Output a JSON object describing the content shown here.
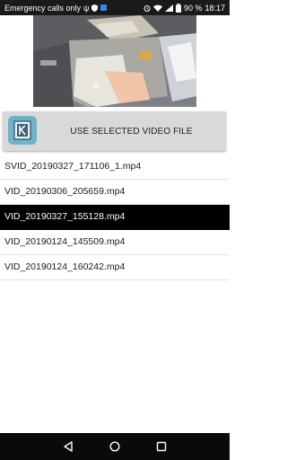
{
  "status_bar": {
    "carrier_text": "Emergency calls only",
    "battery_percent": "90 %",
    "time": "18:17",
    "icons": [
      "usb-icon",
      "shield-icon",
      "tile-icon",
      "alarm-icon",
      "wifi-icon",
      "signal-icon",
      "battery-icon"
    ]
  },
  "action_button": {
    "label": "USE SELECTED VIDEO FILE",
    "logo_icon": "app-logo-icon"
  },
  "file_list": {
    "items": [
      {
        "name": "SVID_20190327_171106_1.mp4",
        "selected": false
      },
      {
        "name": "VID_20190306_205659.mp4",
        "selected": false
      },
      {
        "name": "VID_20190327_155128.mp4",
        "selected": true
      },
      {
        "name": "VID_20190124_145509.mp4",
        "selected": false
      },
      {
        "name": "VID_20190124_160242.mp4",
        "selected": false
      }
    ]
  },
  "nav_bar": {
    "icons": [
      "back-icon",
      "home-icon",
      "recents-icon"
    ]
  },
  "colors": {
    "status_bar_bg": "#1a1a1a",
    "button_bg": "#d9d9d9",
    "selected_row_bg": "#000000",
    "nav_bar_bg": "#0a0a0a"
  }
}
